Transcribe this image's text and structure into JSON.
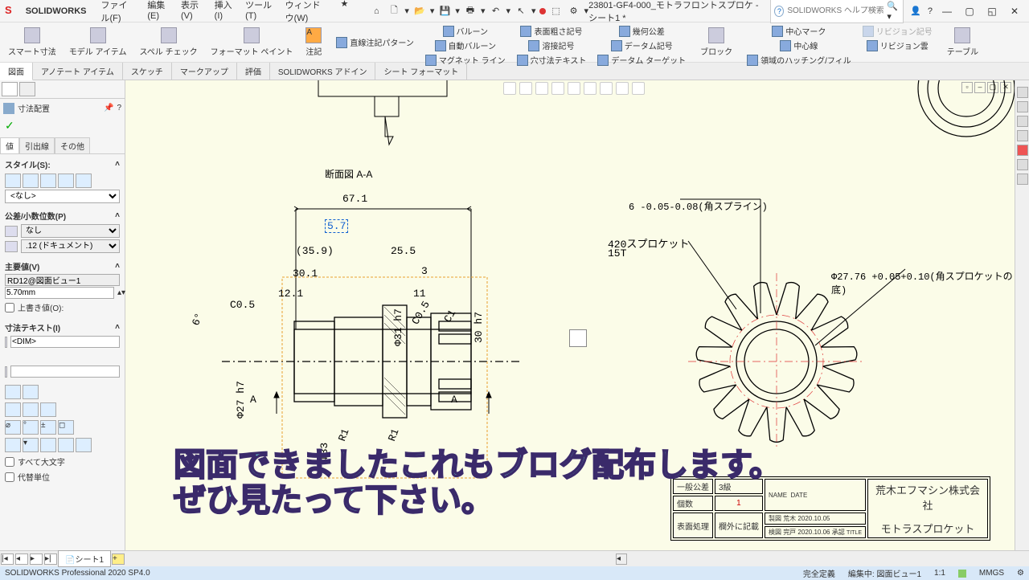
{
  "app": {
    "logo": "S",
    "name": "SOLIDWORKS"
  },
  "menus": [
    "ファイル(F)",
    "編集(E)",
    "表示(V)",
    "挿入(I)",
    "ツール(T)",
    "ウィンドウ(W)"
  ],
  "doc_title": "23801-GF4-000_モトラフロントスプロケ - シート1 *",
  "search_placeholder": "SOLIDWORKS ヘルプ検索",
  "ribbon": {
    "groups": [
      {
        "big": [
          {
            "label": "スマート寸法"
          },
          {
            "label": "モデル\nアイテム"
          },
          {
            "label": "スペル\nチェック"
          },
          {
            "label": "フォーマット\nペイント"
          },
          {
            "label": "注記"
          }
        ]
      },
      {
        "col": [
          "直線注記パターン"
        ]
      },
      {
        "col": [
          {
            "label": "バルーン"
          },
          {
            "label": "自動バルーン"
          },
          {
            "label": "マグネット ライン"
          }
        ]
      },
      {
        "col": [
          {
            "label": "表面粗さ記号"
          },
          {
            "label": "溶接記号"
          },
          {
            "label": "穴寸法テキスト"
          }
        ]
      },
      {
        "col": [
          {
            "label": "幾何公差"
          },
          {
            "label": "データム記号"
          },
          {
            "label": "データム ターゲット"
          }
        ]
      },
      {
        "big": [
          {
            "label": "ブロック"
          }
        ]
      },
      {
        "col": [
          {
            "label": "中心マーク"
          },
          {
            "label": "中心線"
          },
          {
            "label": "領域のハッチング/フィル"
          }
        ]
      },
      {
        "col": [
          {
            "label": "リビジョン記号",
            "disabled": true
          },
          {
            "label": "リビジョン雲"
          }
        ]
      },
      {
        "big": [
          {
            "label": "テーブル"
          }
        ]
      }
    ]
  },
  "tabs": [
    "図面",
    "アノテート アイテム",
    "スケッチ",
    "マークアップ",
    "評価",
    "SOLIDWORKS アドイン",
    "シート フォーマット"
  ],
  "active_tab": 0,
  "property_panel": {
    "title": "寸法配置",
    "subtabs": [
      "値",
      "引出線",
      "その他"
    ],
    "active_subtab": 0,
    "sections": {
      "style": {
        "title": "スタイル(S):",
        "dropdown": "<なし>"
      },
      "tolerance": {
        "title": "公差/小数位数(P)",
        "tol": "なし",
        "dec": ".12 (ドキュメント)"
      },
      "primary": {
        "title": "主要値(V)",
        "name": "RD12@図面ビュー1",
        "value": "5.70mm",
        "override": "上書き値(O):"
      },
      "dimtext": {
        "title": "寸法テキスト(I)",
        "content": "<DIM>"
      },
      "caps": "すべて大文字",
      "alt": "代替単位"
    }
  },
  "drawing": {
    "section_label": "断面図 A-A",
    "dims_left": {
      "d671": "67.1",
      "d57": "5.7",
      "d359": "(35.9)",
      "d255": "25.5",
      "d301": "30.1",
      "d3": "3",
      "d121": "12.1",
      "d11": "11",
      "d31h7": "Φ31 h7",
      "d30h7": "30 h7",
      "d27h7": "Φ27 h7",
      "d33": "Φ33",
      "c05a": "C0.5",
      "c05b": "C0.5",
      "c1": "C1",
      "ang6": "6°",
      "r1a": "R1",
      "r1b": "R1",
      "arrA": "A",
      "arrA2": "A"
    },
    "dims_right": {
      "spline": "6 -0.05-0.08(角スプライン)",
      "sprocket": "420スプロケット",
      "teeth": "15T",
      "dia": "Φ27.76 +0.05+0.10(角スプロケットの底)"
    },
    "titleblock": {
      "row1": {
        "a": "一般公差",
        "b": "3級"
      },
      "row2": {
        "a": "個数",
        "b": "1",
        "c": "製図",
        "d": "荒木",
        "e": "2020.10.05"
      },
      "row3": {
        "a": "表面処理",
        "b": "欄外に記載",
        "c": "検図",
        "d": "完戸",
        "e": "2020.10.06",
        "f": "承認"
      },
      "date_lbl": "DATE",
      "name_lbl": "NAME",
      "title_lbl": "TITLE",
      "company": "荒木エフマシン株式会社",
      "part": "モトラスプロケット"
    }
  },
  "overlay": {
    "line1": "図面できましたこれもブログ配布します。",
    "line2": "ぜひ見たって下さい。"
  },
  "bottom": {
    "sheet": "シート1"
  },
  "status": {
    "product": "SOLIDWORKS Professional 2020 SP4.0",
    "defined": "完全定義",
    "editing": "編集中: 図面ビュー1",
    "ratio": "1:1",
    "units": "MMGS"
  }
}
